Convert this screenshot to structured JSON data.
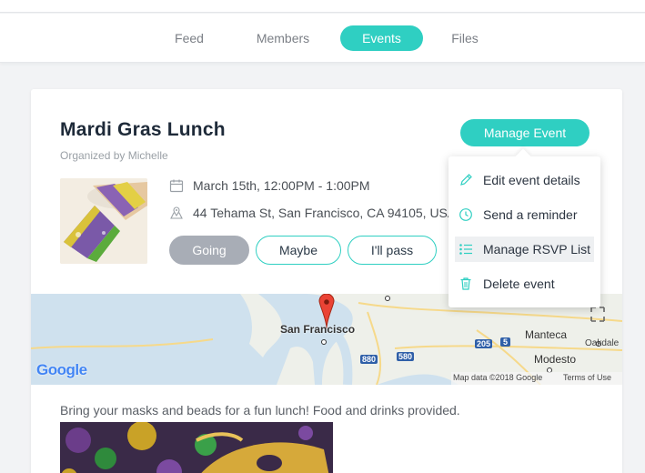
{
  "nav": {
    "tabs": [
      {
        "label": "Feed",
        "active": false
      },
      {
        "label": "Members",
        "active": false
      },
      {
        "label": "Events",
        "active": true
      },
      {
        "label": "Files",
        "active": false
      }
    ]
  },
  "event": {
    "title": "Mardi Gras Lunch",
    "organizer": "Organized by Michelle",
    "date": "March 15th, 12:00PM - 1:00PM",
    "address": "44 Tehama St, San Francisco, CA 94105, USA",
    "description": "Bring your masks and beads for a fun lunch! Food and drinks provided."
  },
  "rsvp": {
    "going": "Going",
    "maybe": "Maybe",
    "pass": "I'll pass"
  },
  "manage": {
    "button_label": "Manage Event",
    "menu": [
      {
        "label": "Edit event details",
        "icon": "pencil-icon"
      },
      {
        "label": "Send a reminder",
        "icon": "clock-icon"
      },
      {
        "label": "Manage RSVP List",
        "icon": "list-icon",
        "highlighted": true
      },
      {
        "label": "Delete event",
        "icon": "trash-icon"
      }
    ]
  },
  "map": {
    "city_label": "San Francisco",
    "labels": [
      "Manteca",
      "Oakdale",
      "Modesto"
    ],
    "shields": [
      "880",
      "580",
      "205",
      "5"
    ],
    "attribution": "Map data ©2018 Google",
    "terms": "Terms of Use",
    "logo": "Google"
  },
  "colors": {
    "accent": "#2fcfc2",
    "going_bg": "#a8adb6"
  }
}
